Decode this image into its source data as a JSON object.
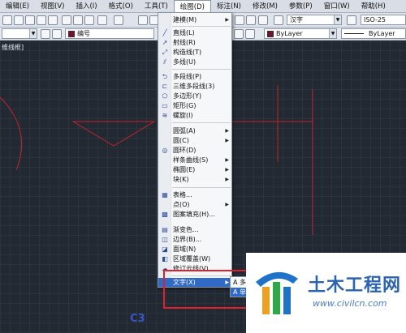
{
  "menubar": {
    "items": [
      "编辑(E)",
      "视图(V)",
      "插入(I)",
      "格式(O)",
      "工具(T)",
      "绘图(D)",
      "标注(N)",
      "修改(M)",
      "参数(P)",
      "窗口(W)",
      "帮助(H)"
    ],
    "active_index": 5
  },
  "toolbar": {
    "text_style": "汉字",
    "dim_style": "ISO-25",
    "layer_name": "编号",
    "color": "ByLayer",
    "linetype": "ByLayer",
    "colors": {
      "layer_swatch": "#7a1030"
    }
  },
  "viewport_label": "维线框]",
  "ucs_label": "C3",
  "draw_menu": {
    "items": [
      {
        "label": "建模(M)",
        "icon": "none",
        "submenu": true
      },
      {
        "label": "直线(L)",
        "icon": "line-icon"
      },
      {
        "label": "射线(R)",
        "icon": "ray-icon"
      },
      {
        "label": "构造线(T)",
        "icon": "xline-icon"
      },
      {
        "label": "多线(U)",
        "icon": "mline-icon"
      },
      {
        "label": "多段线(P)",
        "icon": "pline-icon"
      },
      {
        "label": "三维多段线(3)",
        "icon": "3dpoly-icon"
      },
      {
        "label": "多边形(Y)",
        "icon": "polygon-icon"
      },
      {
        "label": "矩形(G)",
        "icon": "rectangle-icon"
      },
      {
        "label": "螺旋(I)",
        "icon": "helix-icon"
      },
      {
        "label": "圆弧(A)",
        "icon": "none",
        "submenu": true
      },
      {
        "label": "圆(C)",
        "icon": "none",
        "submenu": true
      },
      {
        "label": "圆环(D)",
        "icon": "donut-icon"
      },
      {
        "label": "样条曲线(S)",
        "icon": "none",
        "submenu": true
      },
      {
        "label": "椭圆(E)",
        "icon": "none",
        "submenu": true
      },
      {
        "label": "块(K)",
        "icon": "none",
        "submenu": true
      },
      {
        "label": "表格...",
        "icon": "table-icon"
      },
      {
        "label": "点(O)",
        "icon": "none",
        "submenu": true
      },
      {
        "label": "图案填充(H)...",
        "icon": "hatch-icon"
      },
      {
        "label": "渐变色...",
        "icon": "gradient-icon"
      },
      {
        "label": "边界(B)...",
        "icon": "boundary-icon"
      },
      {
        "label": "面域(N)",
        "icon": "region-icon"
      },
      {
        "label": "区域覆盖(W)",
        "icon": "wipeout-icon"
      },
      {
        "label": "修订云线(V)",
        "icon": "revcloud-icon"
      },
      {
        "label": "文字(X)",
        "icon": "none",
        "submenu": true,
        "highlighted": true
      }
    ]
  },
  "text_submenu": {
    "items": [
      "多",
      "单"
    ]
  },
  "watermark": {
    "title": "土木工程网",
    "url": "www.civilcn.com"
  }
}
